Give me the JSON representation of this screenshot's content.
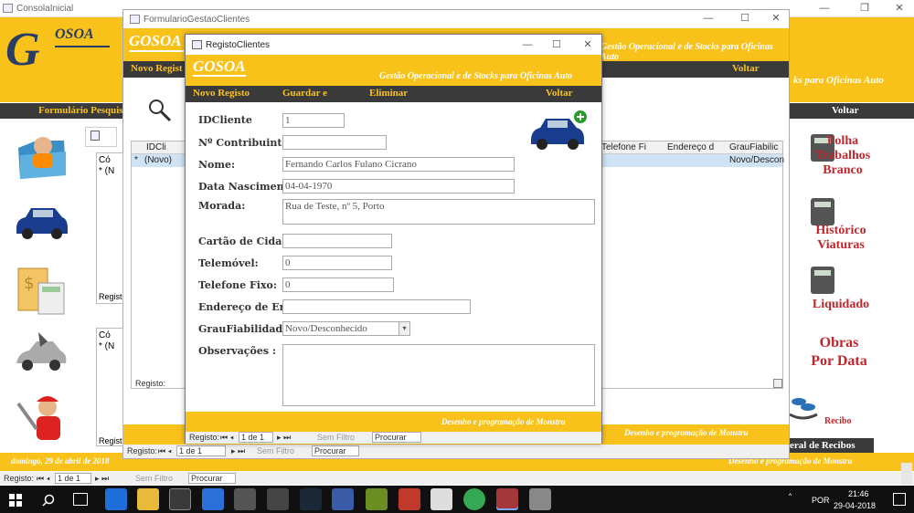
{
  "outer": {
    "window_title": "ConsolaInicial",
    "logo_text": "OSOA",
    "logo_initial": "G",
    "tagline": "Gestão Operacional e de Stocks para Oficinas Auto",
    "tagline_clip": "ks para Oficinas Auto",
    "menu": {
      "pesquisa": "Formulário Pesquisa",
      "voltar": "Voltar"
    },
    "right_labels": [
      "Folha Trabalhos Branco",
      "Histórico Viaturas",
      "Liquidado",
      "Obras Por Data",
      "Recibo"
    ],
    "recibos_tab": "eral de Recibos",
    "status_date": "domingo, 29 de abril de 2018",
    "credit": "Desenho e programação de Monstru",
    "nav": {
      "registo": "Registo:",
      "record": "1 de 1",
      "sem_filtro": "Sem Filtro",
      "procurar": "Procurar"
    }
  },
  "mid": {
    "title": "FormularioGestaoClientes",
    "logo": "GOSOA",
    "menu_first": "Novo Regist",
    "tagline": "Gestão Operacional e de Stocks para Oficinas Auto",
    "voltar": "Voltar",
    "columns": [
      "IDCli",
      "Telefone Fi",
      "Endereço d",
      "GrauFiabilic"
    ],
    "row": {
      "marker": "*",
      "id": "(Novo)",
      "grau": "Novo/Descon"
    },
    "subforms": [
      {
        "header": "Có",
        "row": "* (N",
        "registo": "Regist"
      },
      {
        "header": "Có",
        "row": "* (N",
        "registo": "Regist"
      }
    ],
    "credit": "Desenho e programação de Monstru",
    "nav": {
      "registo": "Registo:",
      "record": "1 de 1",
      "sem_filtro": "Sem Filtro",
      "procurar": "Procurar"
    },
    "inner_registo": "Registo:"
  },
  "dialog": {
    "title": "RegistoClientes",
    "logo": "GOSOA",
    "tagline": "Gestão Operacional e de Stocks para Oficinas Auto",
    "menu": {
      "novo": "Novo Registo",
      "guardar": "Guardar e",
      "eliminar": "Eliminar",
      "voltar": "Voltar"
    },
    "fields": {
      "id_label": "IDCliente",
      "id_value": "1",
      "nif_label": "Nº Contribuinte:",
      "nif_value": "",
      "nome_label": "Nome:",
      "nome_value": "Fernando Carlos Fulano Cicrano",
      "nasc_label": "Data Nascimento:",
      "nasc_value": "04-04-1970",
      "morada_label": "Morada:",
      "morada_value": "Rua de Teste, nº 5, Porto",
      "cc_label": "Cartão de Cidadã",
      "cc_value": "",
      "tlm_label": "Telemóvel:",
      "tlm_value": "0",
      "tel_label": "Telefone Fixo:",
      "tel_value": "0",
      "email_label": "Endereço de Emai",
      "email_value": "",
      "grau_label": "GrauFiabilidade",
      "grau_value": "Novo/Desconhecido",
      "obs_label": "Observações :",
      "obs_value": ""
    },
    "credit": "Desenho e programação de Monstru",
    "nav": {
      "registo": "Registo:",
      "record": "1 de 1",
      "sem_filtro": "Sem Filtro",
      "procurar": "Procurar"
    }
  },
  "taskbar": {
    "lang": "POR",
    "time": "21:46",
    "date": "29-04-2018"
  },
  "colors": {
    "brand_yellow": "#f9c21b",
    "dark_bar": "#3a3a3a",
    "logo_blue": "#2a3d63",
    "label_red": "#c0272d"
  }
}
